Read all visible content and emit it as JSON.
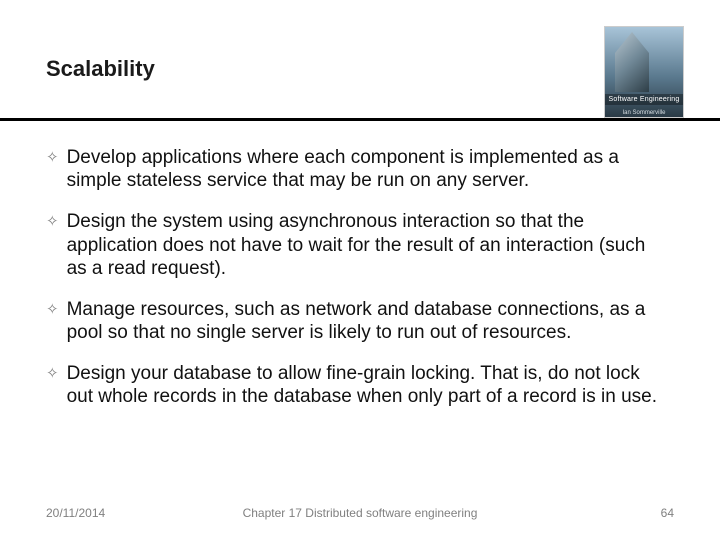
{
  "title": "Scalability",
  "logo": {
    "line1": "Software Engineering",
    "line2": "Ian Sommerville"
  },
  "bullets": [
    "Develop applications where each component is implemented as a simple stateless service that may be run on any server.",
    "Design the system using asynchronous interaction so that the application does not have to wait for the result of an interaction (such as a read request).",
    "Manage resources, such as network and database connections, as a pool so that no single server is likely to run out of resources.",
    "Design your database to allow fine-grain locking. That is, do not lock out whole records in the database when only part of a record is in use."
  ],
  "footer": {
    "date": "20/11/2014",
    "center": "Chapter 17 Distributed software engineering",
    "page": "64"
  },
  "bullet_glyph": "✧"
}
